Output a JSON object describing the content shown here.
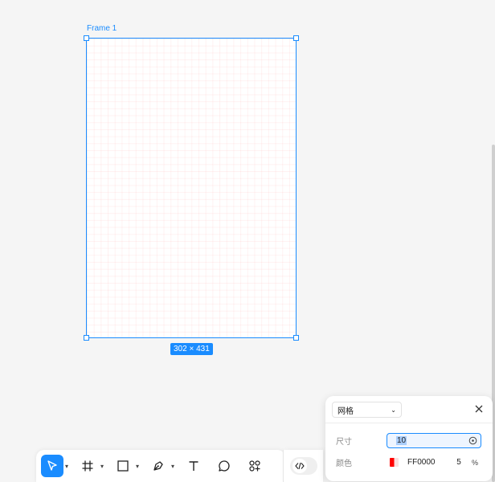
{
  "frame": {
    "label": "Frame 1",
    "size_badge": "302 × 431",
    "grid_color": "#FF0000"
  },
  "toolbar": {
    "tools": [
      {
        "name": "move-tool",
        "icon": "cursor-arrow-icon",
        "active": true,
        "has_dropdown": true
      },
      {
        "name": "frame-tool",
        "icon": "hash-frame-icon",
        "active": false,
        "has_dropdown": true
      },
      {
        "name": "rectangle-tool",
        "icon": "square-icon",
        "active": false,
        "has_dropdown": true
      },
      {
        "name": "pen-tool",
        "icon": "pen-nib-icon",
        "active": false,
        "has_dropdown": true
      },
      {
        "name": "text-tool",
        "icon": "text-t-icon",
        "active": false,
        "has_dropdown": false
      },
      {
        "name": "comment-tool",
        "icon": "speech-bubble-icon",
        "active": false,
        "has_dropdown": false
      },
      {
        "name": "plugins-tool",
        "icon": "shapes-plus-icon",
        "active": false,
        "has_dropdown": false
      }
    ],
    "dev_mode_icon": "code-brackets-icon",
    "accent": "#1A8CFF"
  },
  "grid_panel": {
    "type_selected": "网格",
    "size_label": "尺寸",
    "size_value": "10",
    "color_label": "颜色",
    "color_hex": "FF0000",
    "opacity": "5",
    "percent_sign": "%"
  }
}
